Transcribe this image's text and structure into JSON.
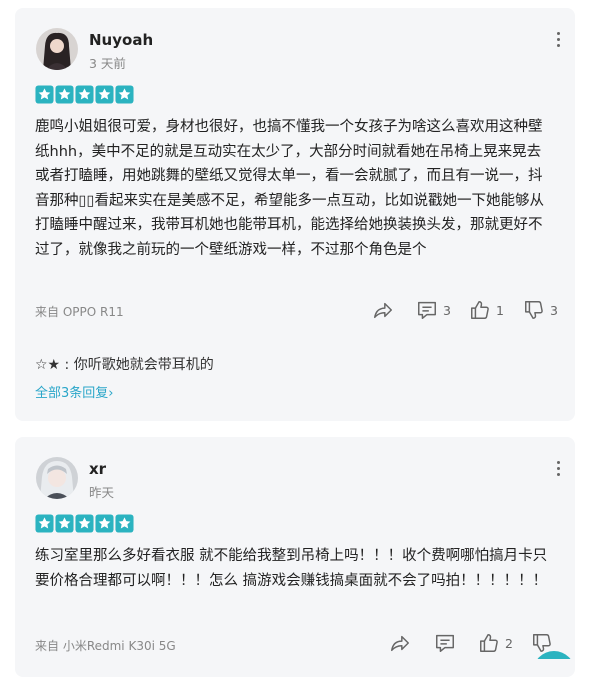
{
  "reviews": [
    {
      "user": "Nuyoah",
      "time": "3 天前",
      "rating": 5,
      "text": "鹿鸣小姐姐很可爱，身材也很好，也搞不懂我一个女孩子为啥这么喜欢用这种壁纸hhh，美中不足的就是互动实在太少了，大部分时间就看她在吊椅上晃来晃去或者打瞌睡，用她跳舞的壁纸又觉得太单一，看一会就腻了，而且有一说一，抖音那种▯▯看起来实在是美感不足，希望能多一点互动，比如说戳她一下她能够从打瞌睡中醒过来，我带耳机她也能带耳机，能选择给她换装换头发，那就更好不过了，就像我之前玩的一个壁纸游戏一样，不过那个角色是个",
      "device": "来自 OPPO R11",
      "comments": "3",
      "likes": "1",
      "dislikes": "3",
      "reply": "☆★ : 你听歌她就会带耳机的",
      "all_replies": "全部3条回复"
    },
    {
      "user": "xr",
      "time": "昨天",
      "rating": 5,
      "text": "练习室里那么多好看衣服 就不能给我整到吊椅上吗！！！收个费啊哪怕搞月卡只要价格合理都可以啊！！！怎么 搞游戏会赚钱搞桌面就不会了吗拍！！！！！！",
      "device": "来自 小米Redmi K30i 5G",
      "likes": "2"
    }
  ],
  "colors": {
    "star": "#2bb3c0",
    "link": "#2aa6c9",
    "card_bg": "#f5f6f8"
  }
}
